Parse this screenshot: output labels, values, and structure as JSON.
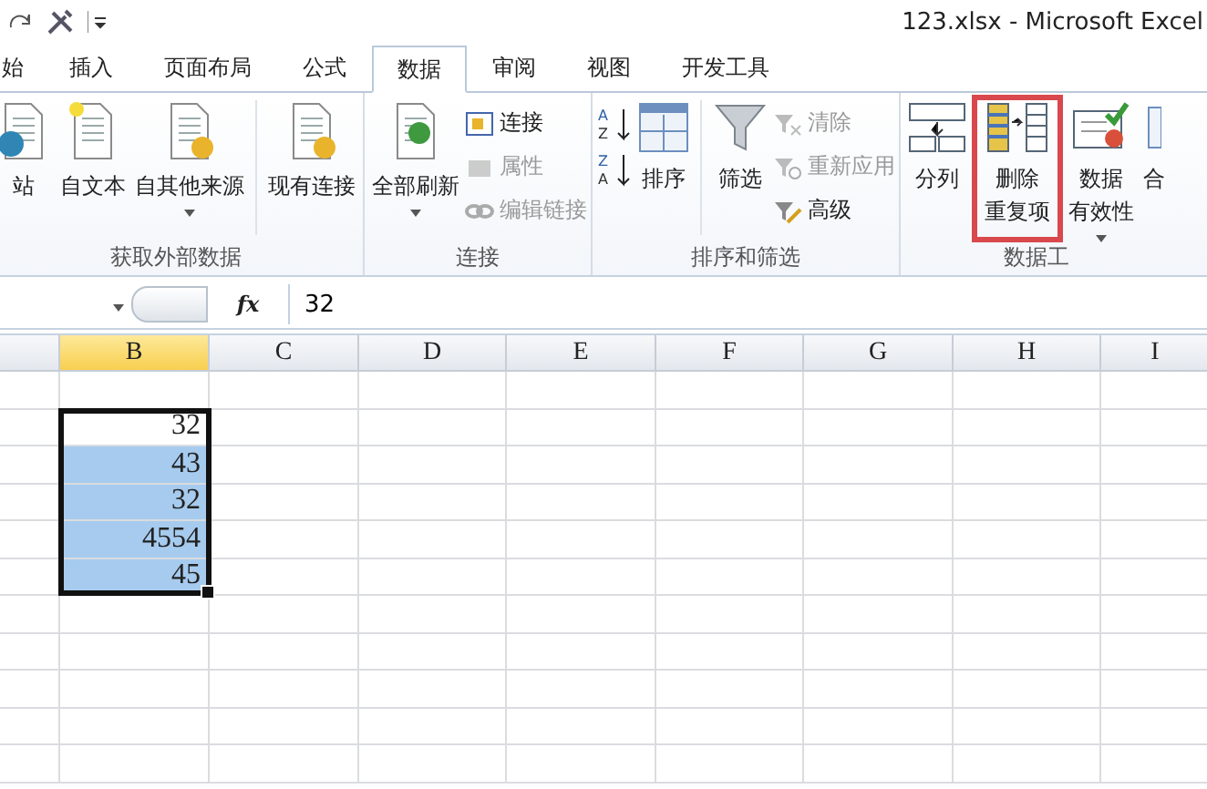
{
  "title": "123.xlsx  -  Microsoft Excel",
  "tabs": [
    {
      "label": "始",
      "selected": false
    },
    {
      "label": "插入",
      "selected": false
    },
    {
      "label": "页面布局",
      "selected": false
    },
    {
      "label": "公式",
      "selected": false
    },
    {
      "label": "数据",
      "selected": true
    },
    {
      "label": "审阅",
      "selected": false
    },
    {
      "label": "视图",
      "selected": false
    },
    {
      "label": "开发工具",
      "selected": false
    }
  ],
  "groups": [
    {
      "label": "获取外部数据",
      "columns": [
        {
          "kind": "large",
          "lines": [
            "站"
          ],
          "caret": false,
          "disabled": false
        },
        {
          "kind": "large",
          "lines": [
            "自文本"
          ],
          "caret": false,
          "disabled": false
        },
        {
          "kind": "large",
          "lines": [
            "自其他来源"
          ],
          "caret": true,
          "disabled": false
        },
        {
          "kind": "divider"
        },
        {
          "kind": "large",
          "lines": [
            "现有连接"
          ],
          "caret": false,
          "disabled": false
        }
      ]
    },
    {
      "label": "连接",
      "columns": [
        {
          "kind": "large",
          "lines": [
            "全部刷新"
          ],
          "caret": true,
          "disabled": false
        },
        {
          "kind": "stack",
          "items": [
            {
              "label": "连接",
              "disabled": false
            },
            {
              "label": "属性",
              "disabled": true
            },
            {
              "label": "编辑链接",
              "disabled": true
            }
          ]
        }
      ]
    },
    {
      "label": "排序和筛选",
      "columns": [
        {
          "kind": "sortpair",
          "letters": [
            [
              "A",
              "Z"
            ],
            [
              "Z",
              "A"
            ]
          ]
        },
        {
          "kind": "large",
          "lines": [
            "排序"
          ],
          "caret": false,
          "disabled": false
        },
        {
          "kind": "divider"
        },
        {
          "kind": "large",
          "lines": [
            "筛选"
          ],
          "caret": false,
          "disabled": false
        },
        {
          "kind": "stack",
          "items": [
            {
              "label": "清除",
              "disabled": true
            },
            {
              "label": "重新应用",
              "disabled": true
            },
            {
              "label": "高级",
              "disabled": false
            }
          ]
        }
      ]
    },
    {
      "label": "数据工",
      "columns": [
        {
          "kind": "large",
          "lines": [
            "分列"
          ],
          "caret": false,
          "disabled": false
        },
        {
          "kind": "large",
          "lines": [
            "删除",
            "重复项"
          ],
          "caret": false,
          "disabled": false,
          "highlighted": true
        },
        {
          "kind": "large",
          "lines": [
            "数据",
            "有效性"
          ],
          "caret": true,
          "disabled": false
        },
        {
          "kind": "large",
          "lines": [
            "合"
          ],
          "caret": false,
          "disabled": false
        }
      ]
    }
  ],
  "formula_bar": {
    "fx_label": "fx",
    "value": "32"
  },
  "columns": [
    {
      "label": "B",
      "selected": true
    },
    {
      "label": "C",
      "selected": false
    },
    {
      "label": "D",
      "selected": false
    },
    {
      "label": "E",
      "selected": false
    },
    {
      "label": "F",
      "selected": false
    },
    {
      "label": "G",
      "selected": false
    },
    {
      "label": "H",
      "selected": false
    },
    {
      "label": "I",
      "selected": false
    }
  ],
  "cells": [
    {
      "value": "32",
      "selected": true,
      "active": true
    },
    {
      "value": "43",
      "selected": true,
      "active": false
    },
    {
      "value": "32",
      "selected": true,
      "active": false
    },
    {
      "value": "4554",
      "selected": true,
      "active": false
    },
    {
      "value": "45",
      "selected": true,
      "active": false
    }
  ]
}
